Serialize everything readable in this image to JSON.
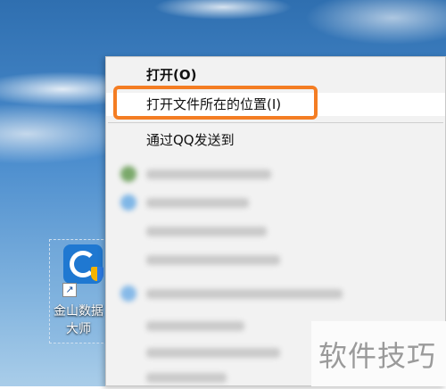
{
  "desktop": {
    "icon_label": "金山数据大师"
  },
  "context_menu": {
    "items": [
      {
        "label": "打开(O)",
        "bold": true
      },
      {
        "label": "打开文件所在的位置(I)",
        "selected": true
      },
      {
        "label": "通过QQ发送到"
      }
    ],
    "blurred_item_count": 9
  },
  "watermark": {
    "text": "软件技巧"
  },
  "colors": {
    "highlight_border": "#f47d23",
    "menu_bg": "#f2f2f2"
  }
}
